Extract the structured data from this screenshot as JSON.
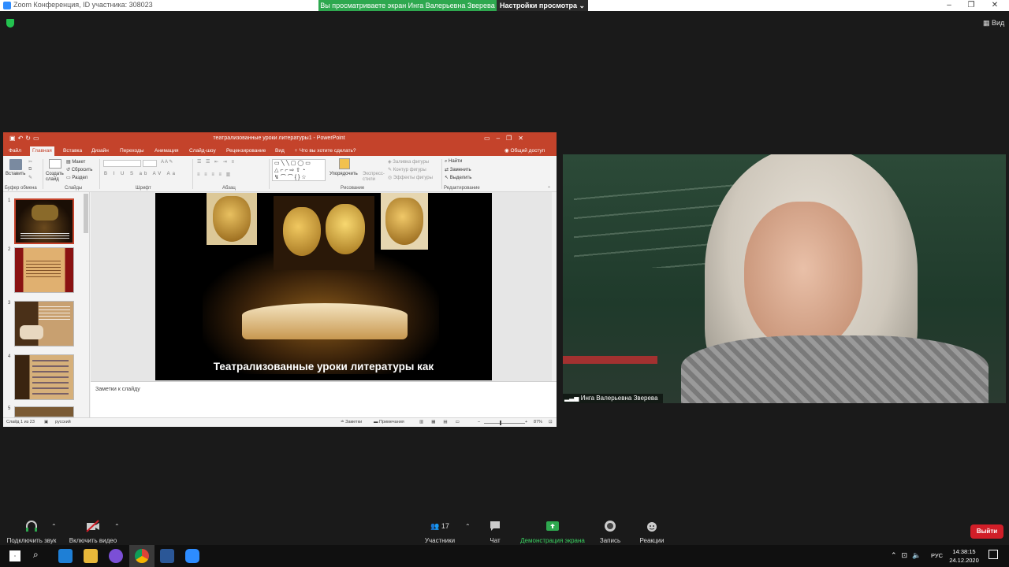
{
  "zoom": {
    "window_title": "Zoom Конференция, ID участника: 308023",
    "share_banner": "Вы просматриваете экран Инга Валерьевна Зверева",
    "view_settings": "Настройки просмотра",
    "view_button": "Вид"
  },
  "ppt": {
    "title": "театрализованные уроки литературы1 - PowerPoint",
    "tabs": [
      "Файл",
      "Главная",
      "Вставка",
      "Дизайн",
      "Переходы",
      "Анимация",
      "Слайд-шоу",
      "Рецензирование",
      "Вид",
      "Что вы хотите сделать?"
    ],
    "share": "Общий доступ",
    "ribbon": {
      "paste": "Вставить",
      "new_slide": "Создать слайд",
      "layout": "Макет",
      "reset": "Сбросить",
      "section": "Раздел",
      "arrange": "Упорядочить",
      "quick_styles": "Экспресс-стили",
      "shape_fill": "Заливка фигуры",
      "shape_outline": "Контур фигуры",
      "shape_effects": "Эффекты фигуры",
      "find": "Найти",
      "replace": "Заменить",
      "select": "Выделить",
      "groups": [
        "Буфер обмена",
        "Слайды",
        "Шрифт",
        "Абзац",
        "Рисование",
        "Редактирование"
      ]
    },
    "thumb_numbers": [
      "1",
      "2",
      "3",
      "4",
      "5"
    ],
    "slide_title": "Театрализованные уроки литературы как",
    "notes_placeholder": "Заметки к слайду",
    "status": {
      "slide": "Слайд 1 из 23",
      "lang": "русский",
      "notes": "Заметки",
      "comments": "Примечания",
      "zoom": "87%"
    }
  },
  "video": {
    "participant_name": "Инга Валерьевна Зверева"
  },
  "toolbar": {
    "audio": "Подключить звук",
    "video": "Включить видео",
    "participants": "Участники",
    "participants_count": "17",
    "chat": "Чат",
    "share": "Демонстрация экрана",
    "record": "Запись",
    "reactions": "Реакции",
    "leave": "Выйти"
  },
  "taskbar": {
    "lang": "РУС",
    "time": "14:38:15",
    "date": "24.12.2020"
  },
  "colors": {
    "ppt_accent": "#c4432b",
    "zoom_green": "#2ea84f",
    "leave_red": "#d11e28"
  }
}
